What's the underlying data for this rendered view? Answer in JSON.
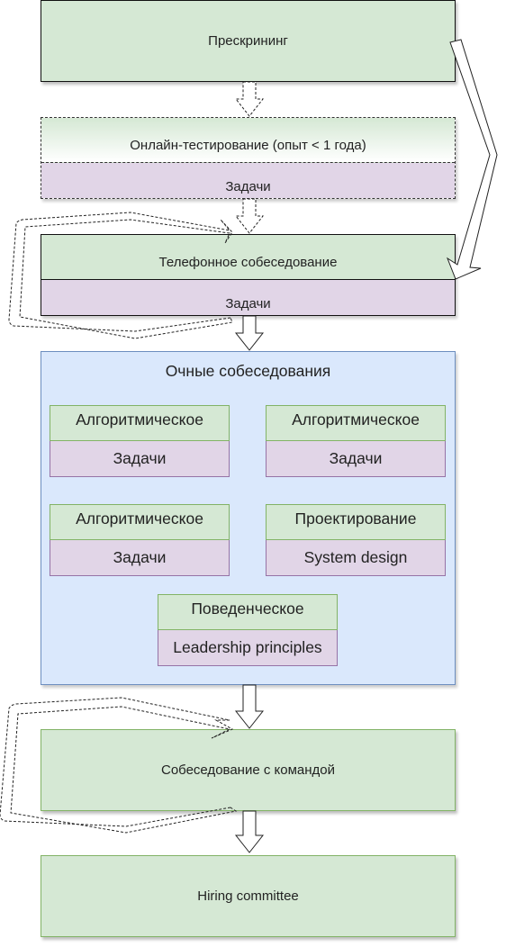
{
  "stages": {
    "prescreening": "Прескрининг",
    "online_test": {
      "title": "Онлайн-тестирование (опыт < 1 года)",
      "sub": "Задачи"
    },
    "phone": {
      "title": "Телефонное собеседование",
      "sub": "Задачи"
    },
    "onsite": {
      "title": "Очные собеседования",
      "cards": [
        {
          "title": "Алгоритмическое",
          "sub": "Задачи"
        },
        {
          "title": "Алгоритмическое",
          "sub": "Задачи"
        },
        {
          "title": "Алгоритмическое",
          "sub": "Задачи"
        },
        {
          "title": "Проектирование",
          "sub": "System design"
        },
        {
          "title": "Поведенческое",
          "sub": "Leadership principles"
        }
      ]
    },
    "team": "Собеседование с командой",
    "committee": "Hiring committee"
  },
  "colors": {
    "green": "#d5e8d4",
    "purple": "#e1d5e7",
    "blue": "#dae8fc",
    "blue_border": "#6c8ebf",
    "green_border": "#82b366"
  }
}
